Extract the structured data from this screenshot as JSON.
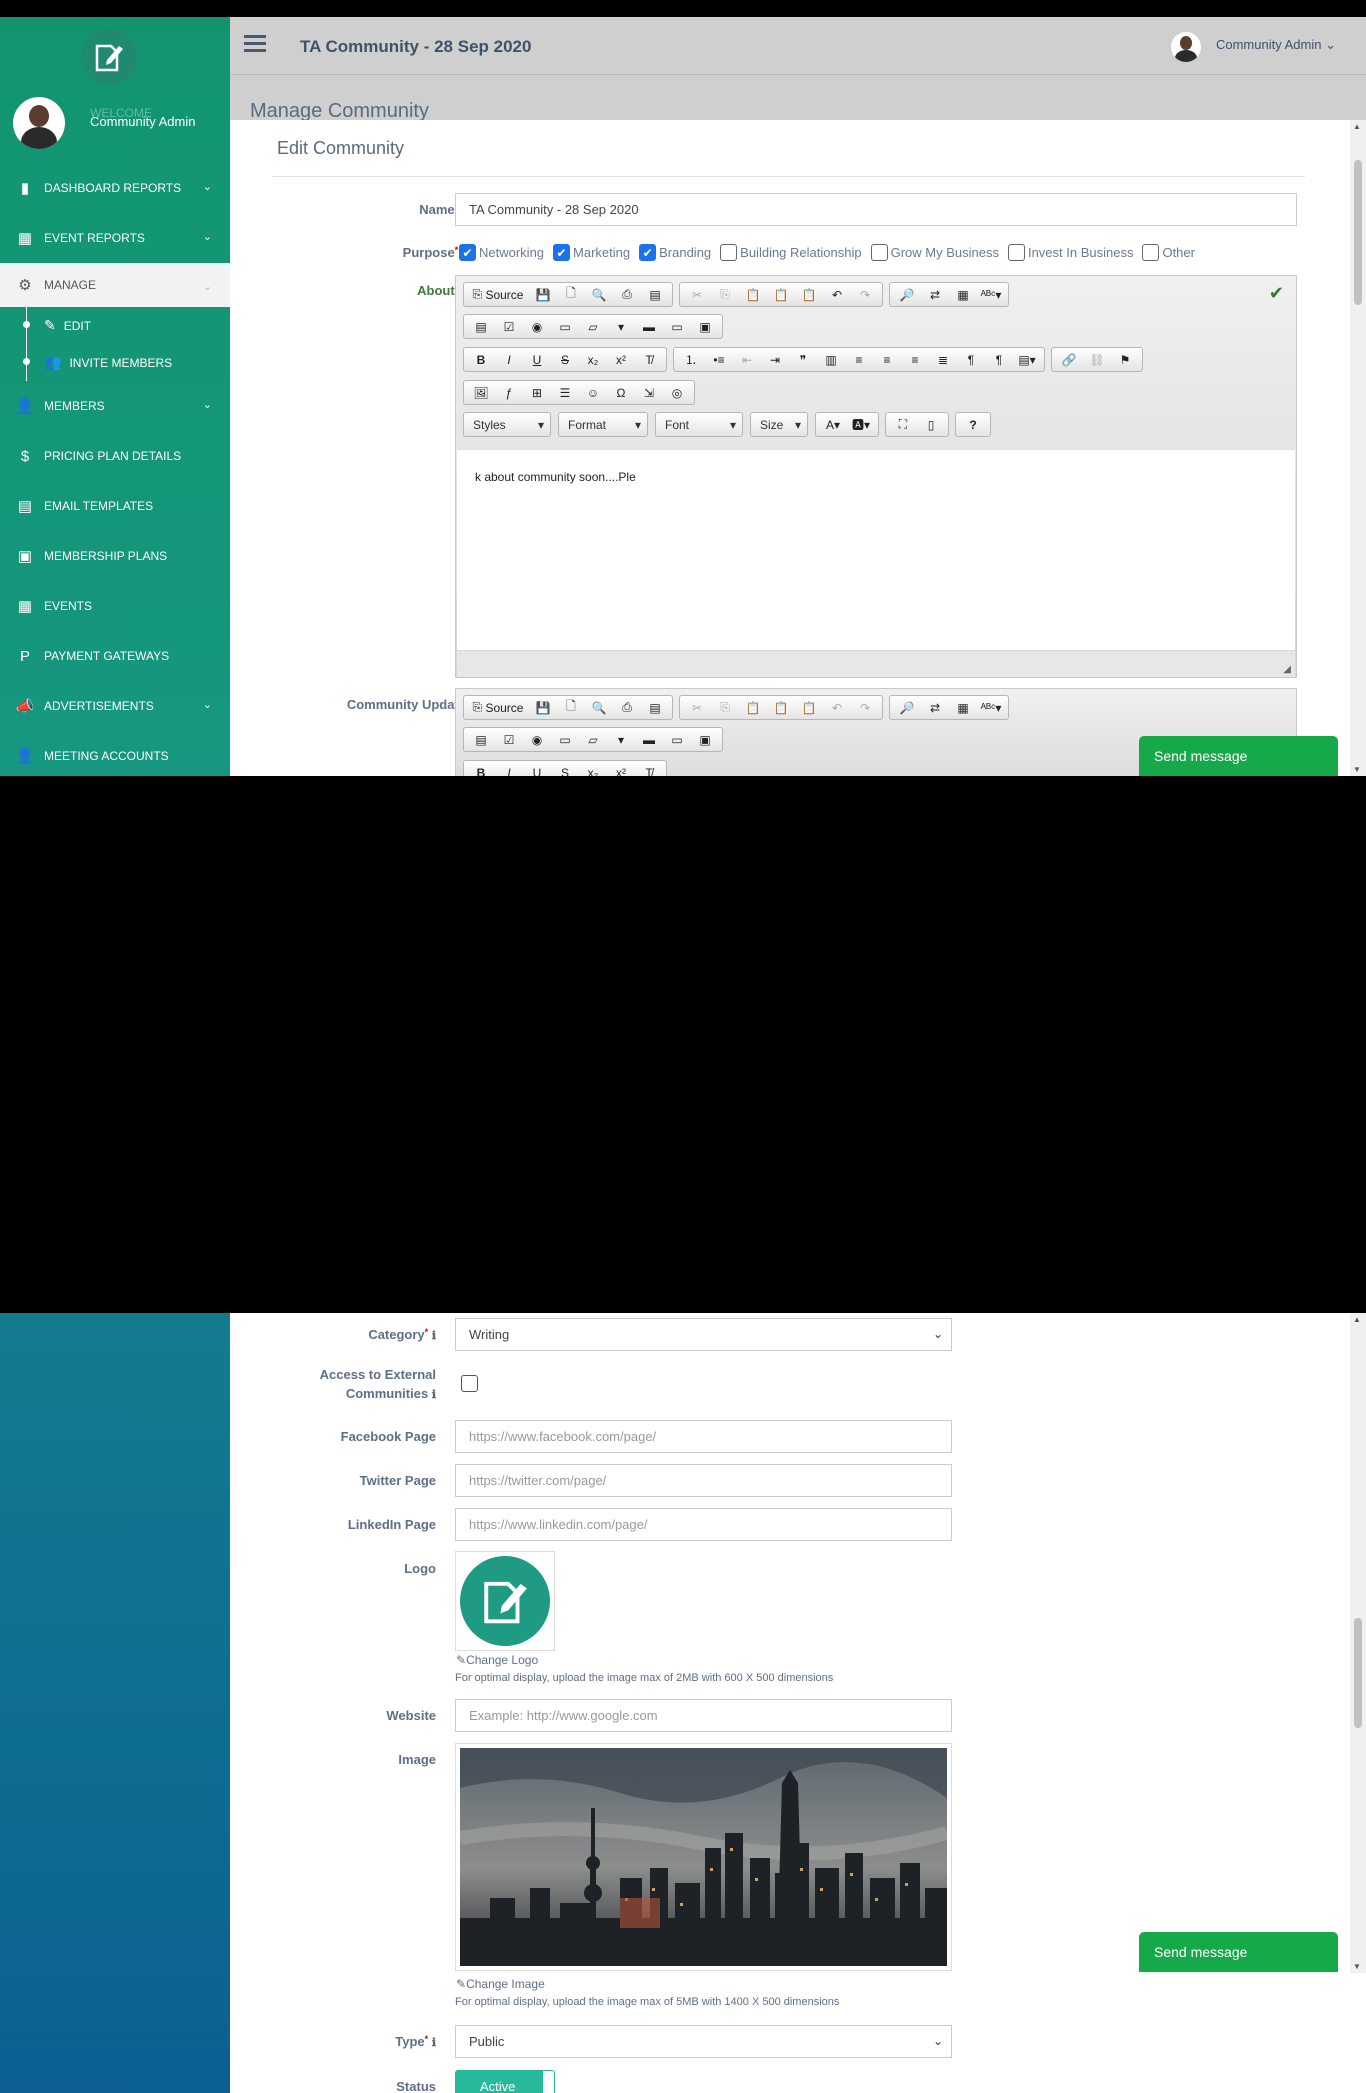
{
  "header": {
    "title": "TA Community - 28 Sep 2020",
    "admin_label": "Community Admin"
  },
  "sidebar": {
    "welcome": "WELCOME",
    "user": "Community Admin",
    "items": [
      {
        "label": "DASHBOARD REPORTS",
        "icon": "bar-chart-icon",
        "glyph": "▮",
        "chevron": true
      },
      {
        "label": "EVENT REPORTS",
        "icon": "grid-icon",
        "glyph": "▦",
        "chevron": true
      },
      {
        "label": "MANAGE",
        "icon": "gears-icon",
        "glyph": "⚙",
        "chevron": true,
        "active": true
      },
      {
        "label": "EDIT",
        "icon": "edit-icon",
        "glyph": "✎",
        "sub": true
      },
      {
        "label": "INVITE MEMBERS",
        "icon": "users-icon",
        "glyph": "👥",
        "sub": true
      },
      {
        "label": "MEMBERS",
        "icon": "user-icon",
        "glyph": "👤",
        "chevron": true
      },
      {
        "label": "PRICING PLAN DETAILS",
        "icon": "dollar-icon",
        "glyph": "$"
      },
      {
        "label": "EMAIL TEMPLATES",
        "icon": "newspaper-icon",
        "glyph": "▤"
      },
      {
        "label": "MEMBERSHIP PLANS",
        "icon": "money-icon",
        "glyph": "▣"
      },
      {
        "label": "EVENTS",
        "icon": "grid-icon",
        "glyph": "▦"
      },
      {
        "label": "PAYMENT GATEWAYS",
        "icon": "paypal-icon",
        "glyph": "P"
      },
      {
        "label": "ADVERTISEMENTS",
        "icon": "bullhorn-icon",
        "glyph": "📣",
        "chevron": true
      },
      {
        "label": "MEETING ACCOUNTS",
        "icon": "user-tie-icon",
        "glyph": "👤"
      }
    ]
  },
  "page": {
    "manage_title": "Manage Community",
    "edit_title": "Edit Community"
  },
  "form": {
    "name_label": "Name",
    "name_value": "TA Community - 28 Sep 2020",
    "purpose_label": "Purpose",
    "purposes": [
      {
        "label": "Networking",
        "checked": true
      },
      {
        "label": "Marketing",
        "checked": true
      },
      {
        "label": "Branding",
        "checked": true
      },
      {
        "label": "Building Relationship",
        "checked": false
      },
      {
        "label": "Grow My Business",
        "checked": false
      },
      {
        "label": "Invest In Business",
        "checked": false
      },
      {
        "label": "Other",
        "checked": false
      }
    ],
    "about_label": "About",
    "about_text": "k about community soon....Ple",
    "community_update_label": "Community Update",
    "category_label": "Category",
    "category_value": "Writing",
    "external_label_1": "Access to External",
    "external_label_2": "Communities",
    "facebook_label": "Facebook Page",
    "facebook_placeholder": "https://www.facebook.com/page/",
    "twitter_label": "Twitter Page",
    "twitter_placeholder": "https://twitter.com/page/",
    "linkedin_label": "LinkedIn Page",
    "linkedin_placeholder": "https://www.linkedin.com/page/",
    "logo_label": "Logo",
    "change_logo": "Change Logo",
    "logo_hint": "For optimal display, upload the image max of 2MB with 600 X 500 dimensions",
    "website_label": "Website",
    "website_placeholder": "Example: http://www.google.com",
    "image_label": "Image",
    "change_image": "Change Image",
    "image_hint": "For optimal display, upload the image max of 5MB with 1400 X 500 dimensions",
    "type_label": "Type",
    "type_value": "Public",
    "status_label": "Status",
    "status_value": "Active"
  },
  "editor": {
    "source": "Source",
    "styles": "Styles",
    "format": "Format",
    "font": "Font",
    "size": "Size",
    "help": "?"
  },
  "send_message": "Send message"
}
